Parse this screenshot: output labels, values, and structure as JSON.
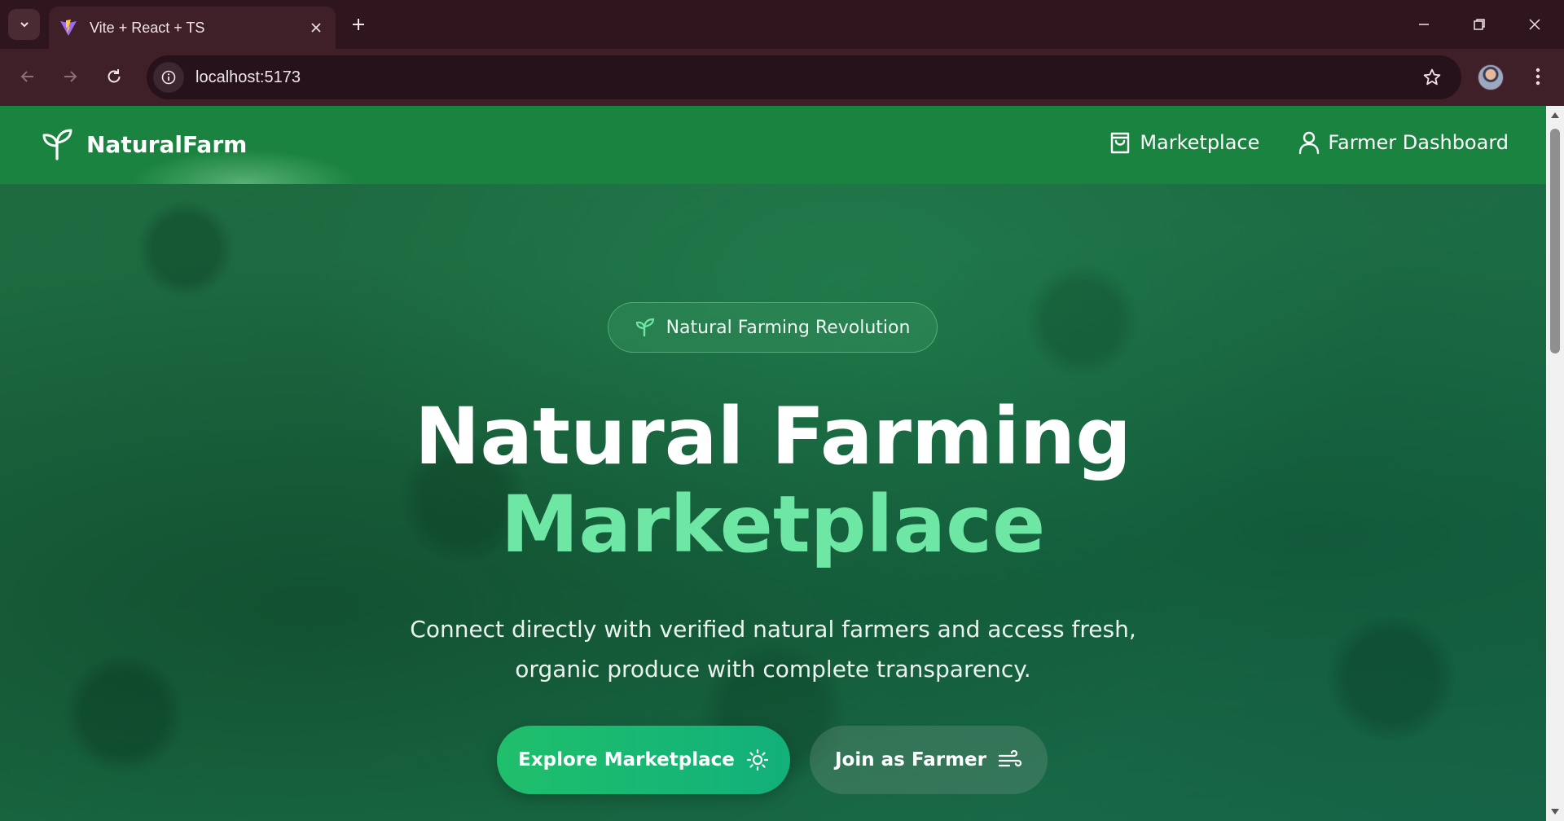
{
  "browser": {
    "tab_title": "Vite + React + TS",
    "url": "localhost:5173"
  },
  "site": {
    "brand": "NaturalFarm",
    "nav": [
      {
        "label": "Marketplace",
        "icon": "shopping-bag-icon"
      },
      {
        "label": "Farmer Dashboard",
        "icon": "user-icon"
      }
    ]
  },
  "hero": {
    "badge": "Natural Farming Revolution",
    "title_line1": "Natural Farming",
    "title_line2": "Marketplace",
    "subtitle": "Connect directly with verified natural farmers and access fresh, organic produce with complete transparency.",
    "primary_button": "Explore Marketplace",
    "secondary_button": "Join as Farmer"
  },
  "colors": {
    "navbar": "#1a833f",
    "accent_title": "#6ee7a4",
    "primary_button": "#1fbf6c"
  }
}
